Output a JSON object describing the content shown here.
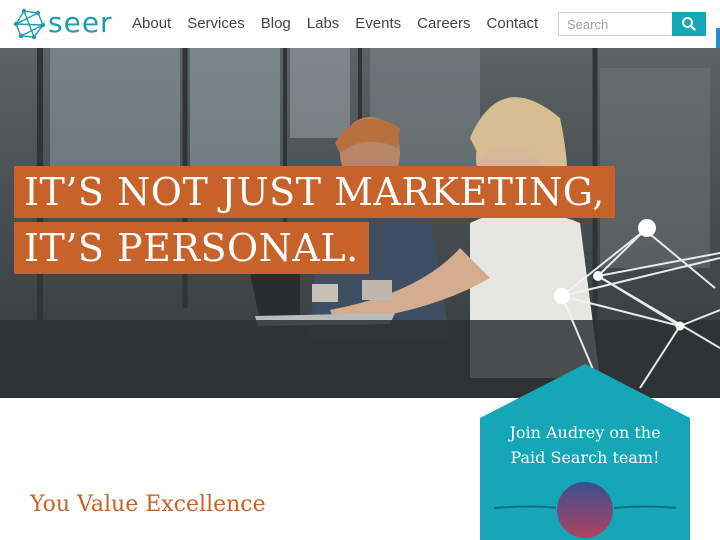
{
  "brand": {
    "name": "seer"
  },
  "nav": {
    "items": [
      "About",
      "Services",
      "Blog",
      "Labs",
      "Events",
      "Careers",
      "Contact"
    ]
  },
  "search": {
    "placeholder": "Search",
    "button_icon": "search-icon"
  },
  "hero": {
    "line1": "IT’S NOT JUST MARKETING,",
    "line2": "IT’S PERSONAL."
  },
  "promo": {
    "line1": "Join Audrey on the",
    "line2": "Paid Search team!"
  },
  "section": {
    "heading": "You Value Excellence"
  },
  "colors": {
    "brand_teal": "#15a6b8",
    "accent_orange": "#c6622a",
    "nav_text": "#444444",
    "side_tab_blue": "#1f8fd1"
  }
}
